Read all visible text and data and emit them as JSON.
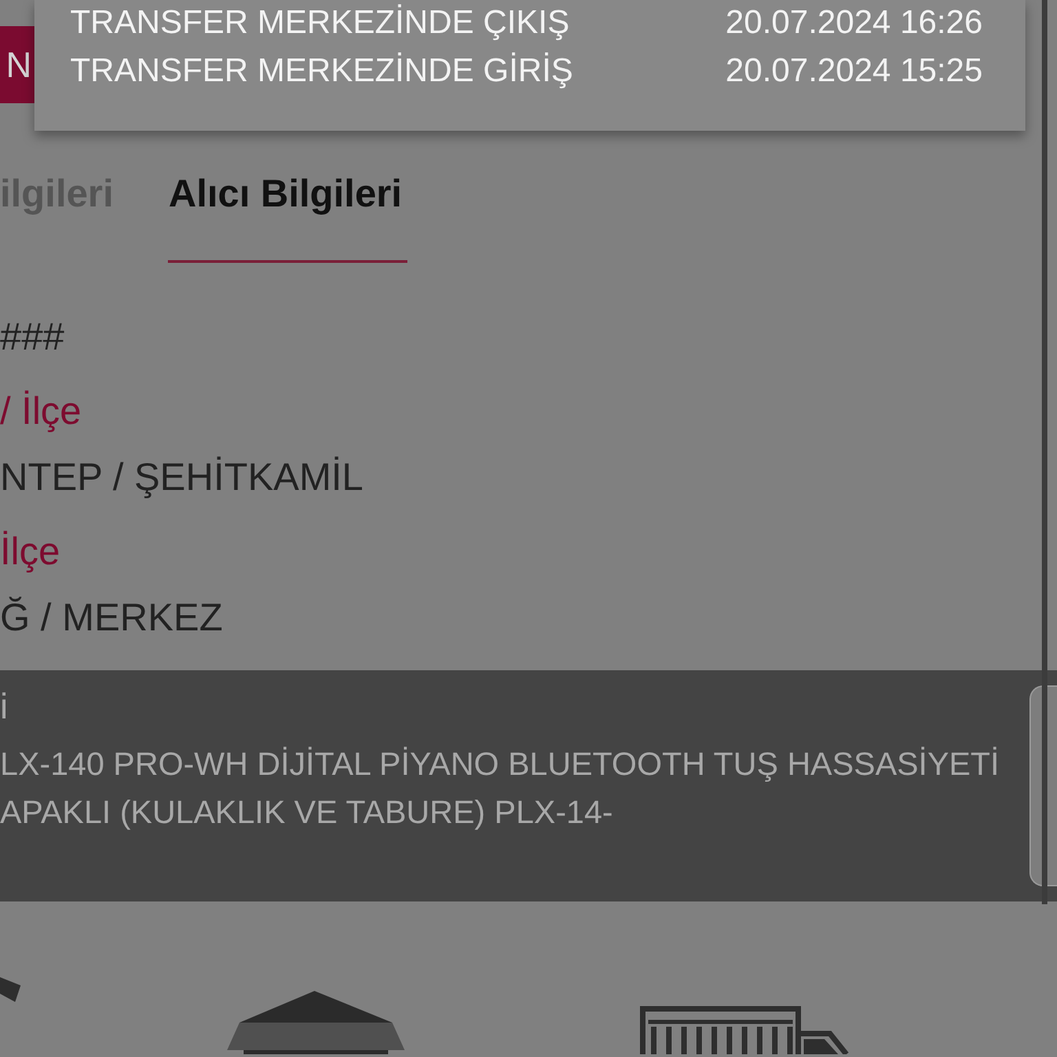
{
  "side_button": {
    "label": "N"
  },
  "tracking_events": [
    {
      "status": "TRANSFER MERKEZİNDE ÇIKIŞ",
      "time": "20.07.2024 16:26"
    },
    {
      "status": "TRANSFER MERKEZİNDE GİRİŞ",
      "time": "20.07.2024 15:25"
    }
  ],
  "tabs": [
    {
      "label": "ilgileri",
      "selected": false
    },
    {
      "label": "Alıcı Bilgileri",
      "selected": true
    }
  ],
  "fields": [
    {
      "value": "###"
    },
    {
      "label": "/ İlçe",
      "value": "NTEP / ŞEHİTKAMİL"
    },
    {
      "label": "İlçe",
      "value": "Ğ / MERKEZ"
    }
  ],
  "product": {
    "title": "i",
    "description_lines": [
      "LX-140 PRO-WH DİJİTAL PİYANO BLUETOOTH TUŞ HASSASİYETİ",
      "APAKLI (KULAKLIK VE TABURE) PLX-14-"
    ]
  }
}
